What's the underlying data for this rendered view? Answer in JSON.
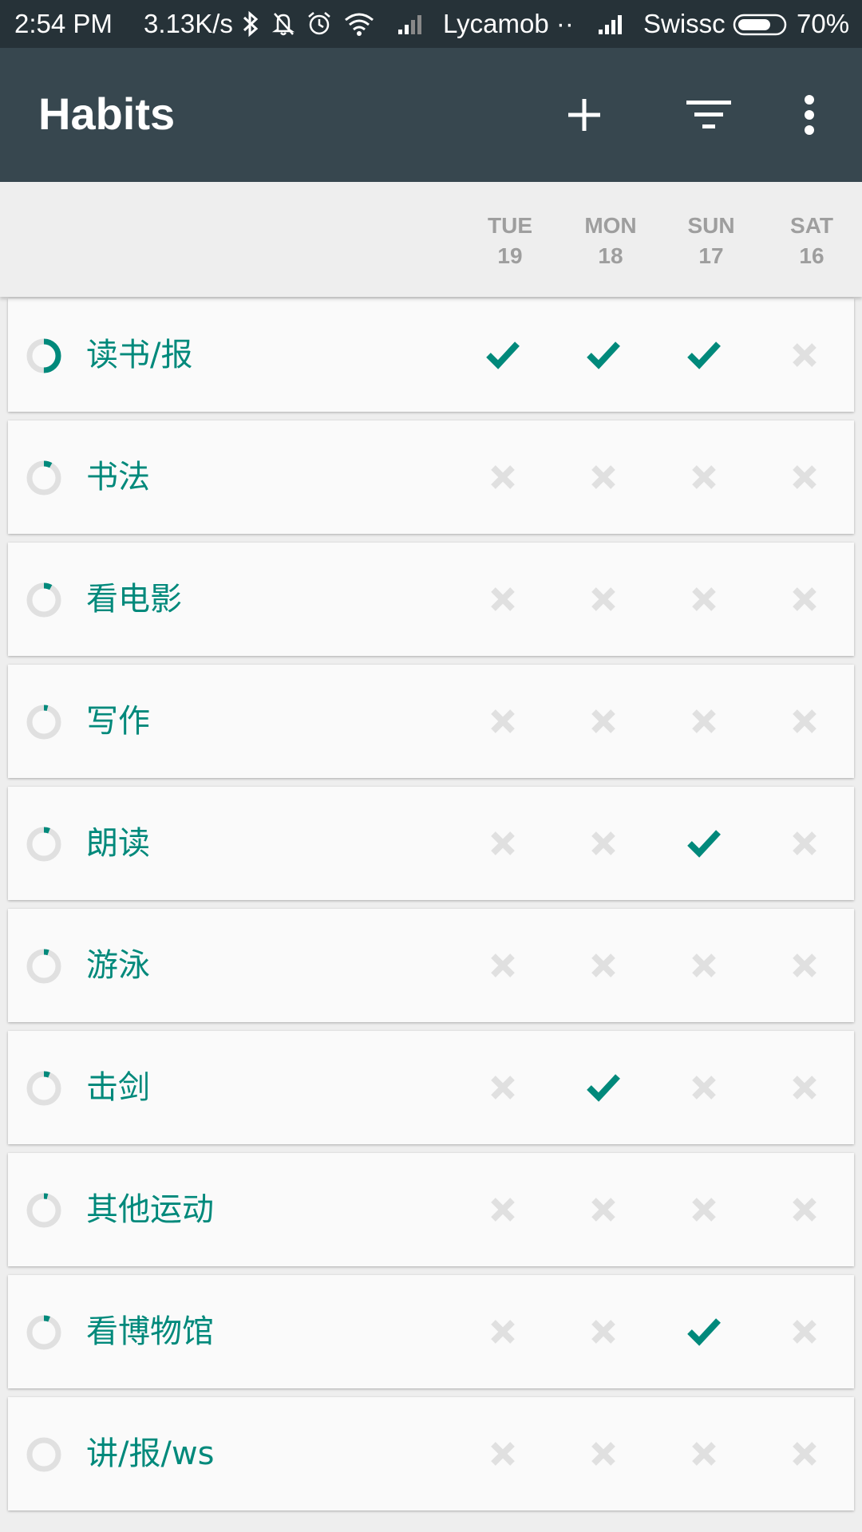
{
  "status_bar": {
    "time": "2:54 PM",
    "speed": "3.13K/s",
    "carrier1": "Lycamob ··",
    "carrier2": "Swissc",
    "battery": "70%"
  },
  "app_bar": {
    "title": "Habits",
    "actions": [
      "add-icon",
      "filter-icon",
      "more-vert-icon"
    ]
  },
  "days": [
    {
      "name": "TUE",
      "date": "19"
    },
    {
      "name": "MON",
      "date": "18"
    },
    {
      "name": "SUN",
      "date": "17"
    },
    {
      "name": "SAT",
      "date": "16"
    }
  ],
  "colors": {
    "accent": "#00897b",
    "unchecked": "#e0e0e0",
    "app_bar": "#37474f",
    "status_bar": "#263238"
  },
  "habits": [
    {
      "name": "读书/报",
      "score": 0.5,
      "checks": [
        true,
        true,
        true,
        false
      ]
    },
    {
      "name": "书法",
      "score": 0.08,
      "checks": [
        false,
        false,
        false,
        false
      ]
    },
    {
      "name": "看电影",
      "score": 0.08,
      "checks": [
        false,
        false,
        false,
        false
      ]
    },
    {
      "name": "写作",
      "score": 0.04,
      "checks": [
        false,
        false,
        false,
        false
      ]
    },
    {
      "name": "朗读",
      "score": 0.06,
      "checks": [
        false,
        false,
        true,
        false
      ]
    },
    {
      "name": "游泳",
      "score": 0.05,
      "checks": [
        false,
        false,
        false,
        false
      ]
    },
    {
      "name": "击剑",
      "score": 0.06,
      "checks": [
        false,
        true,
        false,
        false
      ]
    },
    {
      "name": "其他运动",
      "score": 0.04,
      "checks": [
        false,
        false,
        false,
        false
      ]
    },
    {
      "name": "看博物馆",
      "score": 0.06,
      "checks": [
        false,
        false,
        true,
        false
      ]
    },
    {
      "name": "讲/报/ws",
      "score": 0.0,
      "checks": [
        false,
        false,
        false,
        false
      ]
    }
  ]
}
